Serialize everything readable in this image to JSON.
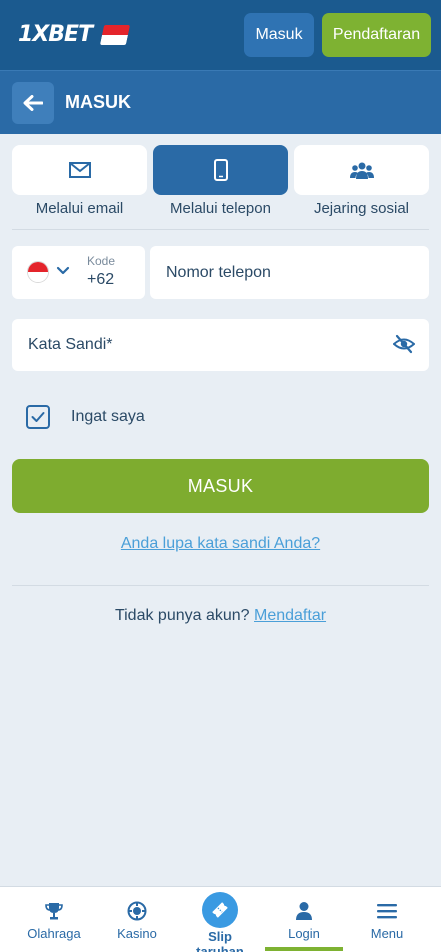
{
  "header": {
    "logo_text": "1XBET",
    "login_label": "Masuk",
    "register_label": "Pendaftaran"
  },
  "titlebar": {
    "title": "MASUK"
  },
  "tabs": [
    {
      "label": "Melalui email",
      "icon": "envelope-icon",
      "active": false
    },
    {
      "label": "Melalui telepon",
      "icon": "mobile-phone-icon",
      "active": true
    },
    {
      "label": "Jejaring sosial",
      "icon": "people-icon",
      "active": false
    }
  ],
  "form": {
    "code_label": "Kode",
    "code_value": "+62",
    "phone_placeholder": "Nomor telepon",
    "password_placeholder": "Kata Sandi*",
    "remember_label": "Ingat saya",
    "remember_checked": true,
    "submit_label": "MASUK",
    "forgot_label": "Anda lupa kata sandi Anda?",
    "no_account_text": "Tidak punya akun?",
    "signup_link": "Mendaftar"
  },
  "bottom_nav": [
    {
      "label": "Olahraga",
      "icon": "trophy-icon"
    },
    {
      "label": "Kasino",
      "icon": "casino-chip-icon"
    },
    {
      "label": "Slip taruhan",
      "icon": "ticket-icon"
    },
    {
      "label": "Login",
      "icon": "user-icon",
      "active": true
    },
    {
      "label": "Menu",
      "icon": "hamburger-icon"
    }
  ],
  "colors": {
    "header_bg": "#1b5a8f",
    "titlebar_bg": "#2a6aa6",
    "accent_green": "#7eac2f",
    "link_blue": "#4a9fd8",
    "page_bg": "#e8eef4"
  }
}
